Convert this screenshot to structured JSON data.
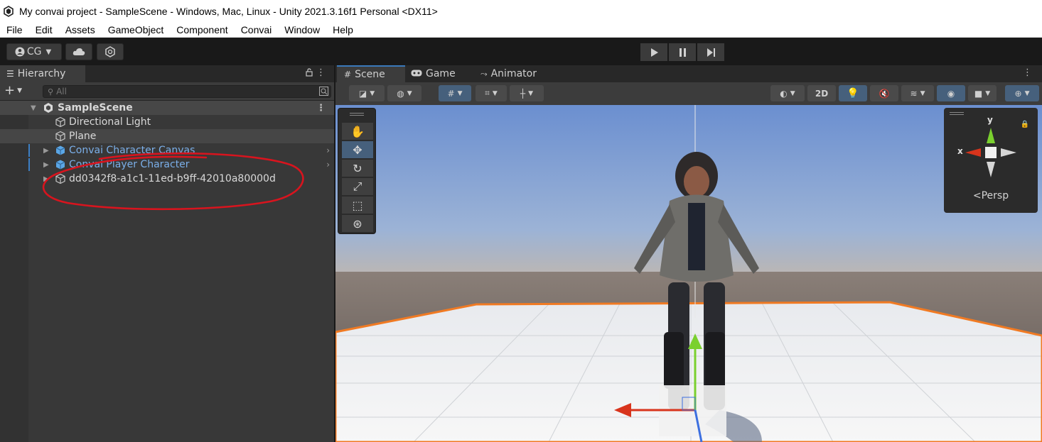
{
  "window": {
    "title": "My convai project - SampleScene - Windows, Mac, Linux - Unity 2021.3.16f1 Personal <DX11>",
    "app_icon": "unity-logo-icon"
  },
  "menu": [
    "File",
    "Edit",
    "Assets",
    "GameObject",
    "Component",
    "Convai",
    "Window",
    "Help"
  ],
  "toolbar": {
    "account_label": "CG",
    "cloud_icon": "cloud-icon",
    "collab_icon": "collab-icon",
    "play_icon": "play-icon",
    "pause_icon": "pause-icon",
    "step_icon": "step-icon"
  },
  "hierarchy": {
    "tab_label": "Hierarchy",
    "search_placeholder": "All",
    "scene_name": "SampleScene",
    "items": [
      {
        "label": "Directional Light",
        "type": "gameobject"
      },
      {
        "label": "Plane",
        "type": "gameobject",
        "selected": true
      },
      {
        "label": "Convai Character Canvas",
        "type": "prefab"
      },
      {
        "label": "Convai Player Character",
        "type": "prefab"
      },
      {
        "label": "dd0342f8-a1c1-11ed-b9ff-42010a80000d",
        "type": "gameobject",
        "annotated": true
      }
    ],
    "annotation_color": "#d8141e"
  },
  "scene_view": {
    "tabs": [
      {
        "label": "Scene",
        "icon": "grid-icon",
        "active": true
      },
      {
        "label": "Game",
        "icon": "gamepad-icon"
      },
      {
        "label": "Animator",
        "icon": "animator-icon"
      }
    ],
    "toggle_2d": "2D",
    "tools": [
      "hand-icon",
      "move-icon",
      "rotate-icon",
      "scale-icon",
      "rect-icon",
      "transform-icon"
    ],
    "active_tool": "move-icon",
    "gizmo": {
      "y_label": "y",
      "x_label": "x",
      "projection_label": "Persp"
    },
    "colors": {
      "sky_top": "#6b8fd0",
      "horizon": "#8a7f78",
      "ground_far": "#5a504c",
      "plane_outline": "#f07a23",
      "x_axis": "#d8341c",
      "y_axis": "#7ad02e",
      "z_axis": "#3c6fe0",
      "accent_blue": "#46607c"
    }
  }
}
